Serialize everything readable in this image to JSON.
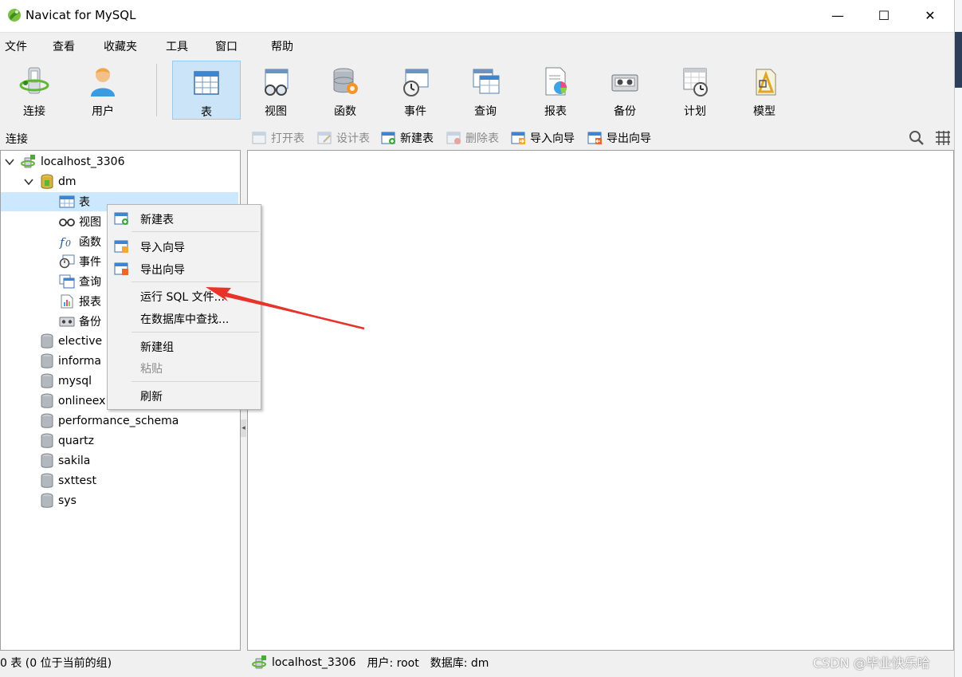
{
  "window": {
    "title": "Navicat for MySQL",
    "controls": {
      "minimize": "—",
      "maximize": "☐",
      "close": "✕"
    }
  },
  "menu": [
    "文件",
    "查看",
    "收藏夹",
    "工具",
    "窗口",
    "帮助"
  ],
  "toolbar": [
    {
      "label": "连接",
      "icon": "connection-icon"
    },
    {
      "label": "用户",
      "icon": "user-icon"
    },
    {
      "label": "表",
      "icon": "table-icon",
      "selected": true
    },
    {
      "label": "视图",
      "icon": "view-icon"
    },
    {
      "label": "函数",
      "icon": "function-icon"
    },
    {
      "label": "事件",
      "icon": "event-icon"
    },
    {
      "label": "查询",
      "icon": "query-icon"
    },
    {
      "label": "报表",
      "icon": "report-icon"
    },
    {
      "label": "备份",
      "icon": "backup-icon"
    },
    {
      "label": "计划",
      "icon": "schedule-icon"
    },
    {
      "label": "模型",
      "icon": "model-icon"
    }
  ],
  "subbar": {
    "left_label": "连接",
    "actions": [
      {
        "label": "打开表",
        "disabled": true
      },
      {
        "label": "设计表",
        "disabled": true
      },
      {
        "label": "新建表",
        "disabled": false
      },
      {
        "label": "删除表",
        "disabled": true
      },
      {
        "label": "导入向导",
        "disabled": false
      },
      {
        "label": "导出向导",
        "disabled": false
      }
    ]
  },
  "tree": {
    "connection": "localhost_3306",
    "database": "dm",
    "objects": [
      "表",
      "视图",
      "函数",
      "事件",
      "查询",
      "报表",
      "备份"
    ],
    "other_databases": [
      "elective",
      "informa",
      "mysql",
      "onlineex",
      "performance_schema",
      "quartz",
      "sakila",
      "sxttest",
      "sys"
    ]
  },
  "context_menu": [
    {
      "label": "新建表",
      "icon": "new-table-icon"
    },
    {
      "label": "导入向导",
      "icon": "import-icon"
    },
    {
      "label": "导出向导",
      "icon": "export-icon"
    },
    {
      "label": "运行 SQL 文件..."
    },
    {
      "label": "在数据库中查找..."
    },
    {
      "label": "新建组"
    },
    {
      "label": "粘贴",
      "disabled": true
    },
    {
      "label": "刷新"
    }
  ],
  "status": {
    "left": "0 表 (0 位于当前的组)",
    "connection": "localhost_3306",
    "user": "用户: root",
    "database": "数据库: dm"
  },
  "watermark": "CSDN @毕业快乐哈",
  "colors": {
    "selection": "#cce4f7",
    "tree_selection": "#cce8ff",
    "arrow": "#e8322a"
  }
}
